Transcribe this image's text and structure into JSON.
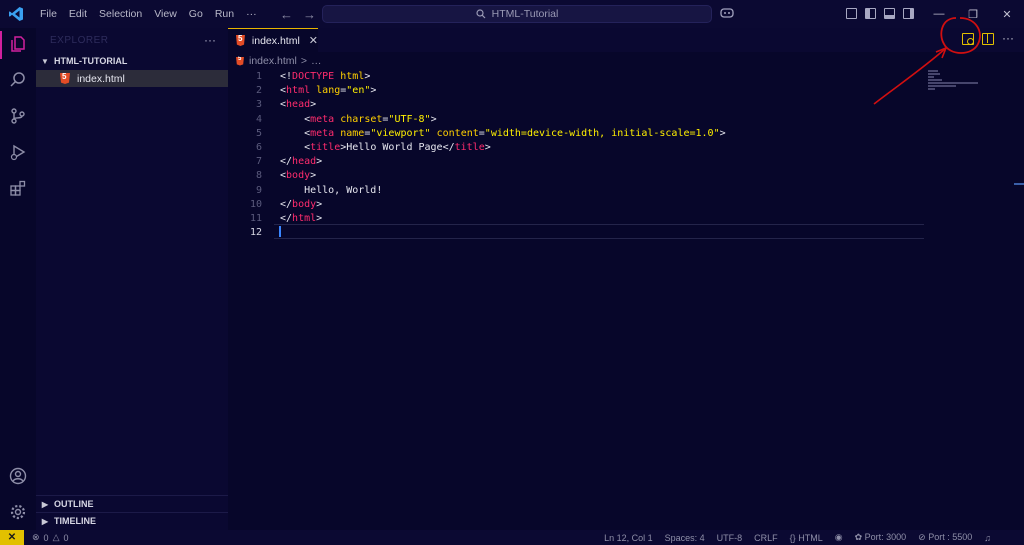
{
  "titlebar": {
    "menu": [
      "File",
      "Edit",
      "Selection",
      "View",
      "Go",
      "Run",
      "···"
    ],
    "search_text": "HTML-Tutorial",
    "back_arrow": "←",
    "forward_arrow": "→",
    "minimize": "—",
    "restore": "❐",
    "close": "✕"
  },
  "sidebar": {
    "header": "EXPLORER",
    "more": "···",
    "folder": "HTML-TUTORIAL",
    "files": [
      "index.html"
    ],
    "sections": [
      "OUTLINE",
      "TIMELINE"
    ]
  },
  "editor": {
    "tab": {
      "label": "index.html",
      "close": "✕"
    },
    "more": "···",
    "breadcrumb": [
      "index.html",
      ">",
      "…"
    ],
    "line_numbers": [
      "1",
      "2",
      "3",
      "4",
      "5",
      "6",
      "7",
      "8",
      "9",
      "10",
      "11",
      "12"
    ],
    "current_line": 12
  },
  "code": [
    [
      [
        "t-txt",
        "<!"
      ],
      [
        "t-tag",
        "DOCTYPE"
      ],
      [
        "t-txt",
        " "
      ],
      [
        "t-attr",
        "html"
      ],
      [
        "t-txt",
        ">"
      ]
    ],
    [
      [
        "t-txt",
        "<"
      ],
      [
        "t-tag",
        "html"
      ],
      [
        "t-txt",
        " "
      ],
      [
        "t-attr",
        "lang"
      ],
      [
        "t-txt",
        "="
      ],
      [
        "t-str",
        "\"en\""
      ],
      [
        "t-txt",
        ">"
      ]
    ],
    [
      [
        "t-txt",
        "<"
      ],
      [
        "t-tag",
        "head"
      ],
      [
        "t-txt",
        ">"
      ]
    ],
    [
      [
        "t-txt",
        "    <"
      ],
      [
        "t-tag",
        "meta"
      ],
      [
        "t-txt",
        " "
      ],
      [
        "t-attr",
        "charset"
      ],
      [
        "t-txt",
        "="
      ],
      [
        "t-str",
        "\"UTF-8\""
      ],
      [
        "t-txt",
        ">"
      ]
    ],
    [
      [
        "t-txt",
        "    <"
      ],
      [
        "t-tag",
        "meta"
      ],
      [
        "t-txt",
        " "
      ],
      [
        "t-attr",
        "name"
      ],
      [
        "t-txt",
        "="
      ],
      [
        "t-str",
        "\"viewport\""
      ],
      [
        "t-txt",
        " "
      ],
      [
        "t-attr",
        "content"
      ],
      [
        "t-txt",
        "="
      ],
      [
        "t-str",
        "\"width=device-width, initial-scale=1.0\""
      ],
      [
        "t-txt",
        ">"
      ]
    ],
    [
      [
        "t-txt",
        "    <"
      ],
      [
        "t-tag",
        "title"
      ],
      [
        "t-txt",
        ">Hello World Page</"
      ],
      [
        "t-tag",
        "title"
      ],
      [
        "t-txt",
        ">"
      ]
    ],
    [
      [
        "t-txt",
        "</"
      ],
      [
        "t-tag",
        "head"
      ],
      [
        "t-txt",
        ">"
      ]
    ],
    [
      [
        "t-txt",
        "<"
      ],
      [
        "t-tag",
        "body"
      ],
      [
        "t-txt",
        ">"
      ]
    ],
    [
      [
        "t-txt",
        "    Hello, World!"
      ]
    ],
    [
      [
        "t-txt",
        "</"
      ],
      [
        "t-tag",
        "body"
      ],
      [
        "t-txt",
        ">"
      ]
    ],
    [
      [
        "t-txt",
        "</"
      ],
      [
        "t-tag",
        "html"
      ],
      [
        "t-txt",
        ">"
      ]
    ],
    [
      [
        "t-txt",
        ""
      ]
    ]
  ],
  "statusbar": {
    "remote": "✕",
    "errors": "0",
    "warnings": "0",
    "position": "Ln 12, Col 1",
    "spaces": "Spaces: 4",
    "encoding": "UTF-8",
    "eol": "CRLF",
    "language": "HTML",
    "port1": "Port: 3000",
    "port2": "Port : 5500"
  },
  "colors": {
    "accent_tab": "#e8b400",
    "activity_active": "#d0209e",
    "annotation": "#d10f10"
  },
  "icons": [
    "vscode-logo-icon",
    "explorer-icon",
    "search-icon",
    "source-control-icon",
    "run-debug-icon",
    "extensions-icon",
    "account-icon",
    "settings-gear-icon",
    "open-preview-icon",
    "split-editor-icon"
  ]
}
